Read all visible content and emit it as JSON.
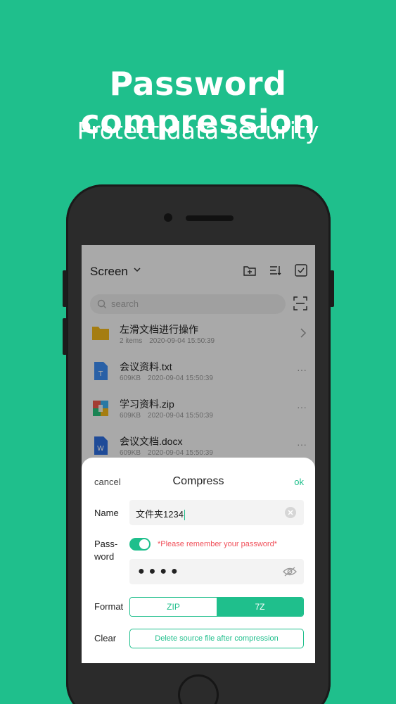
{
  "headline": "Password compression",
  "subline": "Protect data security",
  "colors": {
    "brand": "#1fbf8c",
    "warning": "#f0505a"
  },
  "app": {
    "screen_title": "Screen",
    "toolbar_icons": [
      "new-folder-icon",
      "sort-icon",
      "select-icon"
    ],
    "search_placeholder": "search",
    "files": [
      {
        "name": "左滑文档进行操作",
        "size": "2 items",
        "date": "2020-09-04 15:50:39",
        "icon": "folder-icon",
        "action": "chevron-right-icon"
      },
      {
        "name": "会议资料.txt",
        "size": "609KB",
        "date": "2020-09-04 15:50:39",
        "icon": "txt-file-icon",
        "action": "more-icon"
      },
      {
        "name": "学习资料.zip",
        "size": "609KB",
        "date": "2020-09-04 15:50:39",
        "icon": "zip-file-icon",
        "action": "more-icon"
      },
      {
        "name": "会议文档.docx",
        "size": "609KB",
        "date": "2020-09-04 15:50:39",
        "icon": "word-file-icon",
        "action": "more-icon"
      }
    ]
  },
  "dialog": {
    "cancel": "cancel",
    "title": "Compress",
    "ok": "ok",
    "name_label": "Name",
    "name_value": "文件夹1234",
    "password_label": "Pass-\nword",
    "password_hint": "*Please remember your password*",
    "password_dots": "●●●●",
    "format_label": "Format",
    "formats": [
      "ZIP",
      "7Z"
    ],
    "selected_format": "7Z",
    "clear_label": "Clear",
    "delete_source": "Delete source file after compression"
  }
}
